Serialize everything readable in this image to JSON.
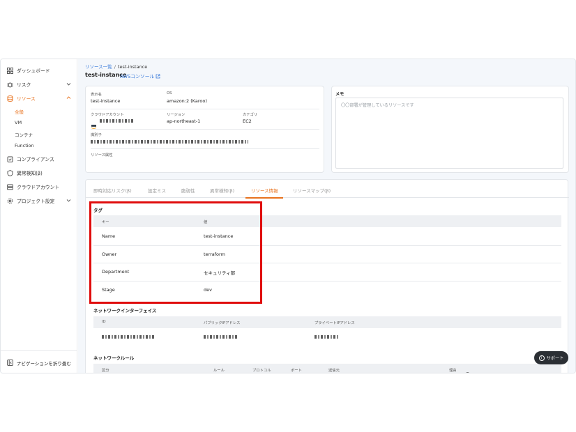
{
  "sidebar": {
    "items": [
      {
        "label": "ダッシュボード",
        "icon": "dashboard-icon"
      },
      {
        "label": "リスク",
        "icon": "bug-icon"
      },
      {
        "label": "リソース",
        "icon": "database-icon"
      },
      {
        "label": "コンプライアンス",
        "icon": "clipboard-check-icon"
      },
      {
        "label": "異常検知(β)",
        "icon": "shield-icon"
      },
      {
        "label": "クラウドアカウント",
        "icon": "server-icon"
      },
      {
        "label": "プロジェクト設定",
        "icon": "gear-icon"
      }
    ],
    "sub_items": [
      "全般",
      "VM",
      "コンテナ",
      "Function"
    ],
    "collapse_label": "ナビゲーションを折り畳む"
  },
  "breadcrumb": {
    "parent": "リソース一覧",
    "separator": "/",
    "current": "test-instance"
  },
  "page": {
    "title": "test-instance",
    "aws_link": "AWSコンソール"
  },
  "info_card": {
    "display_name_label": "表示名",
    "display_name": "test-instance",
    "os_label": "OS",
    "os": "amazon:2 (Karoo)",
    "cloud_account_label": "クラウドアカウント",
    "region_label": "リージョン",
    "region": "ap-northeast-1",
    "category_label": "カテゴリ",
    "category": "EC2",
    "identifier_label": "識別子",
    "attributes_label": "リソース属性"
  },
  "memo": {
    "title": "メモ",
    "placeholder": "〇〇部署が管理しているリソースです"
  },
  "tabs": [
    "即時対応リスク(β)",
    "設定ミス",
    "脆弱性",
    "異常検知(β)",
    "リソース情報",
    "リソースマップ(β)"
  ],
  "tags": {
    "title": "タグ",
    "key_header": "キー",
    "value_header": "値",
    "rows": [
      {
        "key": "Name",
        "value": "test-instance"
      },
      {
        "key": "Owner",
        "value": "terraform"
      },
      {
        "key": "Department",
        "value": "セキュリティ部"
      },
      {
        "key": "Stage",
        "value": "dev"
      }
    ]
  },
  "network_interface": {
    "title": "ネットワークインターフェイス",
    "headers": [
      "ID",
      "パブリックIPアドレス",
      "プライベートIPアドレス"
    ]
  },
  "network_rules": {
    "title": "ネットワークルール",
    "headers": [
      "区分",
      "ルール",
      "プロトコル",
      "ポート",
      "送信元",
      "理由"
    ]
  },
  "support_label": "サポート",
  "colors": {
    "accent": "#e8711c",
    "link": "#3477d9",
    "highlight": "#e00d0d"
  }
}
